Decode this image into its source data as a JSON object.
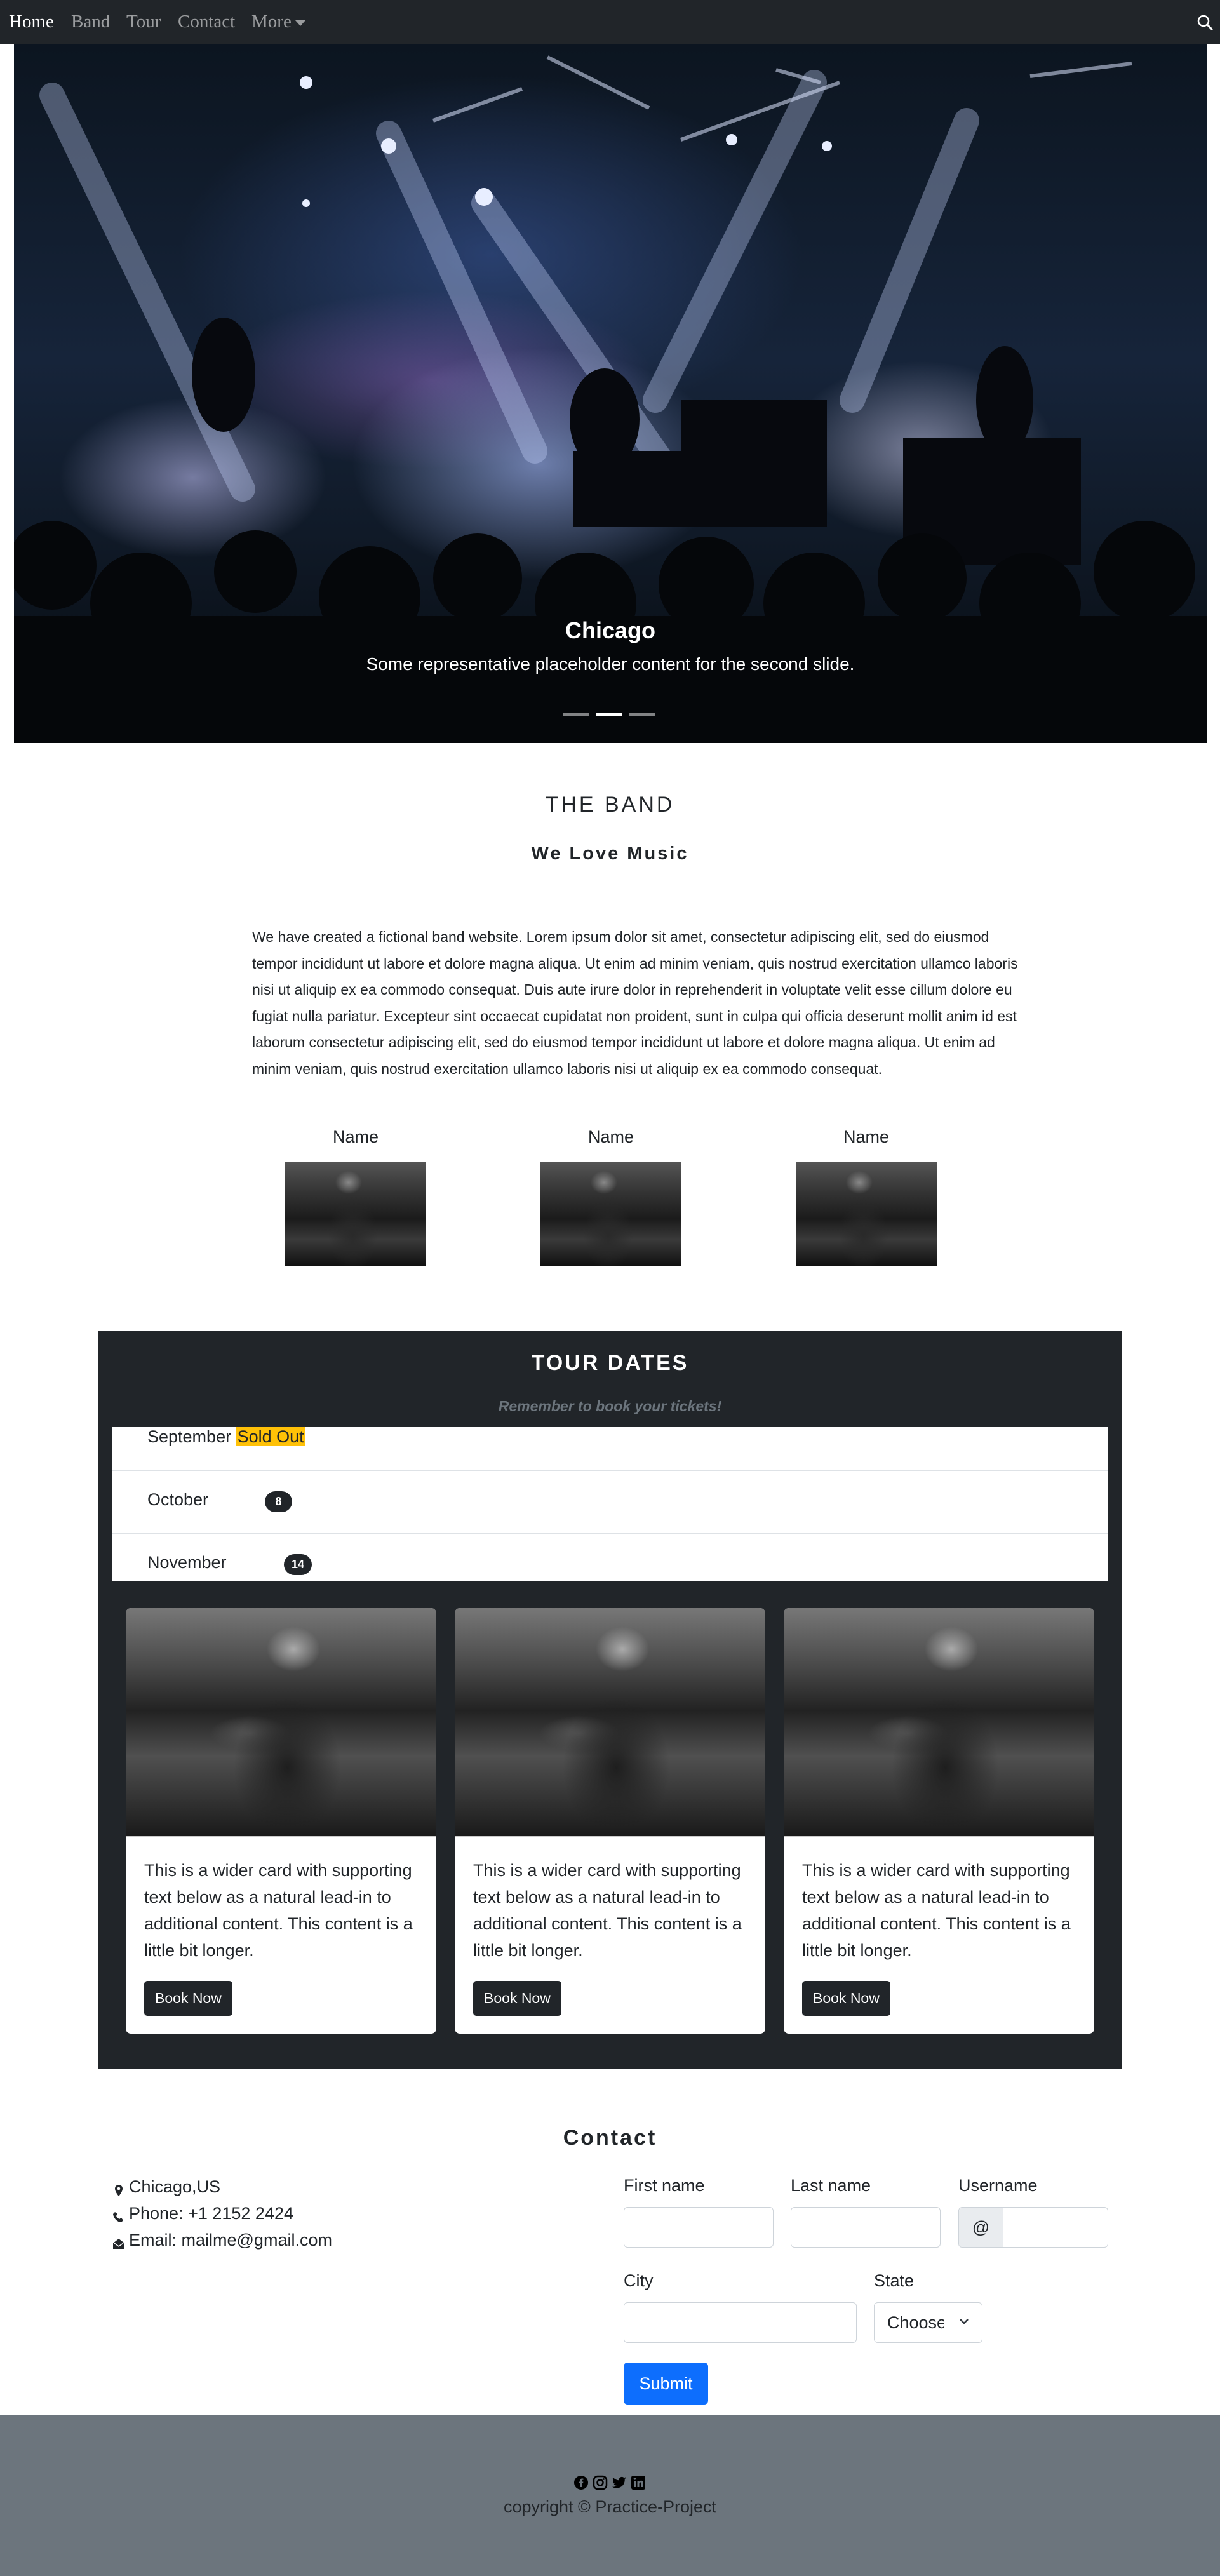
{
  "navbar": {
    "items": [
      "Home",
      "Band",
      "Tour",
      "Contact",
      "More"
    ],
    "active": "Home",
    "search_icon": "search-icon"
  },
  "hero": {
    "title": "Chicago",
    "text": "Some representative placeholder content for the second slide.",
    "slides_total": 3,
    "active_slide": 2
  },
  "band": {
    "heading": "THE BAND",
    "subheading": "We Love Music",
    "paragraph": "We have created a fictional band website. Lorem ipsum dolor sit amet, consectetur adipiscing elit, sed do eiusmod tempor incididunt ut labore et dolore magna aliqua. Ut enim ad minim veniam, quis nostrud exercitation ullamco laboris nisi ut aliquip ex ea commodo consequat. Duis aute irure dolor in reprehenderit in voluptate velit esse cillum dolore eu fugiat nulla pariatur. Excepteur sint occaecat cupidatat non proident, sunt in culpa qui officia deserunt mollit anim id est laborum consectetur adipiscing elit, sed do eiusmod tempor incididunt ut labore et dolore magna aliqua. Ut enim ad minim veniam, quis nostrud exercitation ullamco laboris nisi ut aliquip ex ea commodo consequat.",
    "members": [
      {
        "name": "Name"
      },
      {
        "name": "Name"
      },
      {
        "name": "Name"
      }
    ]
  },
  "tour": {
    "title": "TOUR DATES",
    "subtitle": "Remember to book your tickets!",
    "months": [
      {
        "month": "September",
        "badge": "Sold Out"
      },
      {
        "month": "October",
        "count": "8"
      },
      {
        "month": "November",
        "count": "14"
      }
    ],
    "cards": [
      {
        "text": "This is a wider card with supporting text below as a natural lead-in to additional content. This content is a little bit longer.",
        "button": "Book Now"
      },
      {
        "text": "This is a wider card with supporting text below as a natural lead-in to additional content. This content is a little bit longer.",
        "button": "Book Now"
      },
      {
        "text": "This is a wider card with supporting text below as a natural lead-in to additional content. This content is a little bit longer.",
        "button": "Book Now"
      }
    ]
  },
  "contact": {
    "title": "Contact",
    "location": "Chicago,US",
    "phone": "Phone: +1 2152 2424",
    "email": "Email: mailme@gmail.com",
    "form": {
      "first_name_label": "First name",
      "last_name_label": "Last name",
      "username_label": "Username",
      "username_prefix": "@",
      "city_label": "City",
      "state_label": "State",
      "state_selected": "Choose...",
      "submit": "Submit"
    }
  },
  "footer": {
    "social_icons": [
      "facebook-icon",
      "instagram-icon",
      "twitter-icon",
      "linkedin-icon"
    ],
    "copyright": "copyright © Practice-Project"
  },
  "colors": {
    "navbar_bg": "#212529",
    "footer_bg": "#6c757d",
    "submit_bg": "#0d6efd",
    "sold_out_bg": "#ffc107"
  }
}
